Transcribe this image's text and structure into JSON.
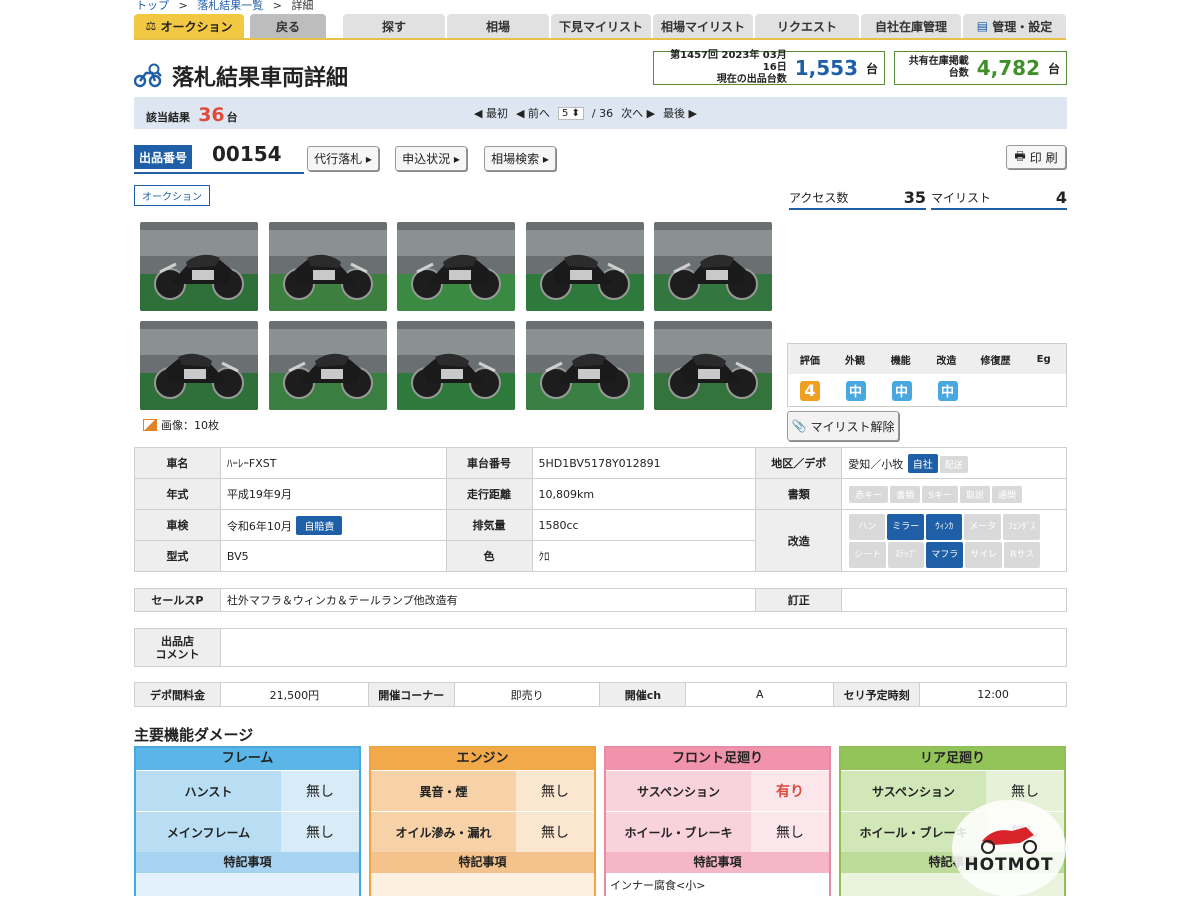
{
  "breadcrumb": {
    "top": "トップ",
    "sep1": ">",
    "list": "落札結果一覧",
    "sep2": ">",
    "detail": "詳細"
  },
  "tabs": {
    "auction": "オークション",
    "back": "戻る",
    "search": "探す",
    "market": "相場",
    "shitami": "下見マイリスト",
    "market_mylist": "相場マイリスト",
    "request": "リクエスト",
    "stock": "自社在庫管理",
    "admin": "管理・設定"
  },
  "page_title": "落札結果車両詳細",
  "session": {
    "line1": "第1457回 2023年 03月 16日",
    "line2": "現在の出品台数",
    "count": "1,553",
    "unit": "台"
  },
  "shared": {
    "label": "共有在庫掲載台数",
    "count": "4,782",
    "unit": "台"
  },
  "results": {
    "label": "該当結果",
    "count": "36",
    "unit": "台",
    "first": "◀ 最初",
    "prev": "◀ 前へ",
    "page": "5",
    "total": "/ 36",
    "next": "次へ ▶",
    "last": "最後 ▶"
  },
  "listing": {
    "label": "出品番号",
    "number": "00154",
    "btn_proxy": "代行落札 ▸",
    "btn_status": "申込状況 ▸",
    "btn_market": "相場検索 ▸",
    "print": "印 刷",
    "auction_tag": "オークション"
  },
  "access": {
    "label": "アクセス数",
    "count": "35",
    "mylist_label": "マイリスト",
    "mylist_count": "4"
  },
  "images": {
    "label": "画像：10枚"
  },
  "grade": {
    "headers": [
      "評価",
      "外観",
      "機能",
      "改造",
      "修復歴",
      "Eg"
    ],
    "score": "4",
    "exterior": "中",
    "function": "中",
    "mod": "中",
    "colors": {
      "score": "#f0a020",
      "mid": "#4aa8e0"
    }
  },
  "mylist_remove": "マイリスト解除",
  "spec": {
    "name_label": "車名",
    "name": "ﾊｰﾚｰFXST",
    "frame_label": "車台番号",
    "frame": "5HD1BV5178Y012891",
    "region_label": "地区／デポ",
    "region": "愛知／小牧",
    "chip_own": "自社",
    "chip_ship": "配送",
    "year_label": "年式",
    "year": "平成19年9月",
    "mileage_label": "走行距離",
    "mileage": "10,809km",
    "docs_label": "書類",
    "docs": [
      "赤キー",
      "書類",
      "Sキー",
      "取説",
      "通関"
    ],
    "inspect_label": "車検",
    "inspect": "令和6年10月",
    "inspect_chip": "自賠責",
    "cc_label": "排気量",
    "cc": "1580cc",
    "mod_label": "改造",
    "mods1": [
      "ハン",
      "ミラー",
      "ｳｨﾝｶ",
      "メータ",
      "ﾌｪﾝﾀﾞｽ"
    ],
    "mods2": [
      "シート",
      "ｽﾃｯﾌﾟ",
      "マフラ",
      "サイレ",
      "Rサス"
    ],
    "type_label": "型式",
    "type": "BV5",
    "color_label": "色",
    "color": "ｸﾛ"
  },
  "sales": {
    "label": "セールスP",
    "text": "社外マフラ＆ウィンカ＆テールランプ他改造有",
    "fix_label": "訂正"
  },
  "comment": {
    "label1": "出品店",
    "label2": "コメント"
  },
  "fees": {
    "depot_label": "デポ間料金",
    "depot": "21,500円",
    "corner_label": "開催コーナー",
    "corner": "即売り",
    "ch_label": "開催ch",
    "ch": "A",
    "time_label": "セリ予定時刻",
    "time": "12:00"
  },
  "damage": {
    "title": "主要機能ダメージ",
    "frame": {
      "title": "フレーム",
      "r1k": "ハンスト",
      "r1v": "無し",
      "r2k": "メインフレーム",
      "r2v": "無し",
      "sub": "特記事項",
      "note": ""
    },
    "engine": {
      "title": "エンジン",
      "r1k": "異音・煙",
      "r1v": "無し",
      "r2k": "オイル滲み・漏れ",
      "r2v": "無し",
      "sub": "特記事項",
      "note": ""
    },
    "front": {
      "title": "フロント足廻り",
      "r1k": "サスペンション",
      "r1v": "有り",
      "r2k": "ホイール・ブレーキ",
      "r2v": "無し",
      "sub": "特記事項",
      "note": "インナー腐食<小>"
    },
    "rear": {
      "title": "リア足廻り",
      "r1k": "サスペンション",
      "r1v": "無し",
      "r2k": "ホイール・ブレーキ",
      "r2v": "無し",
      "sub": "特記事項",
      "note": ""
    }
  },
  "watermark": "HOTMOT"
}
